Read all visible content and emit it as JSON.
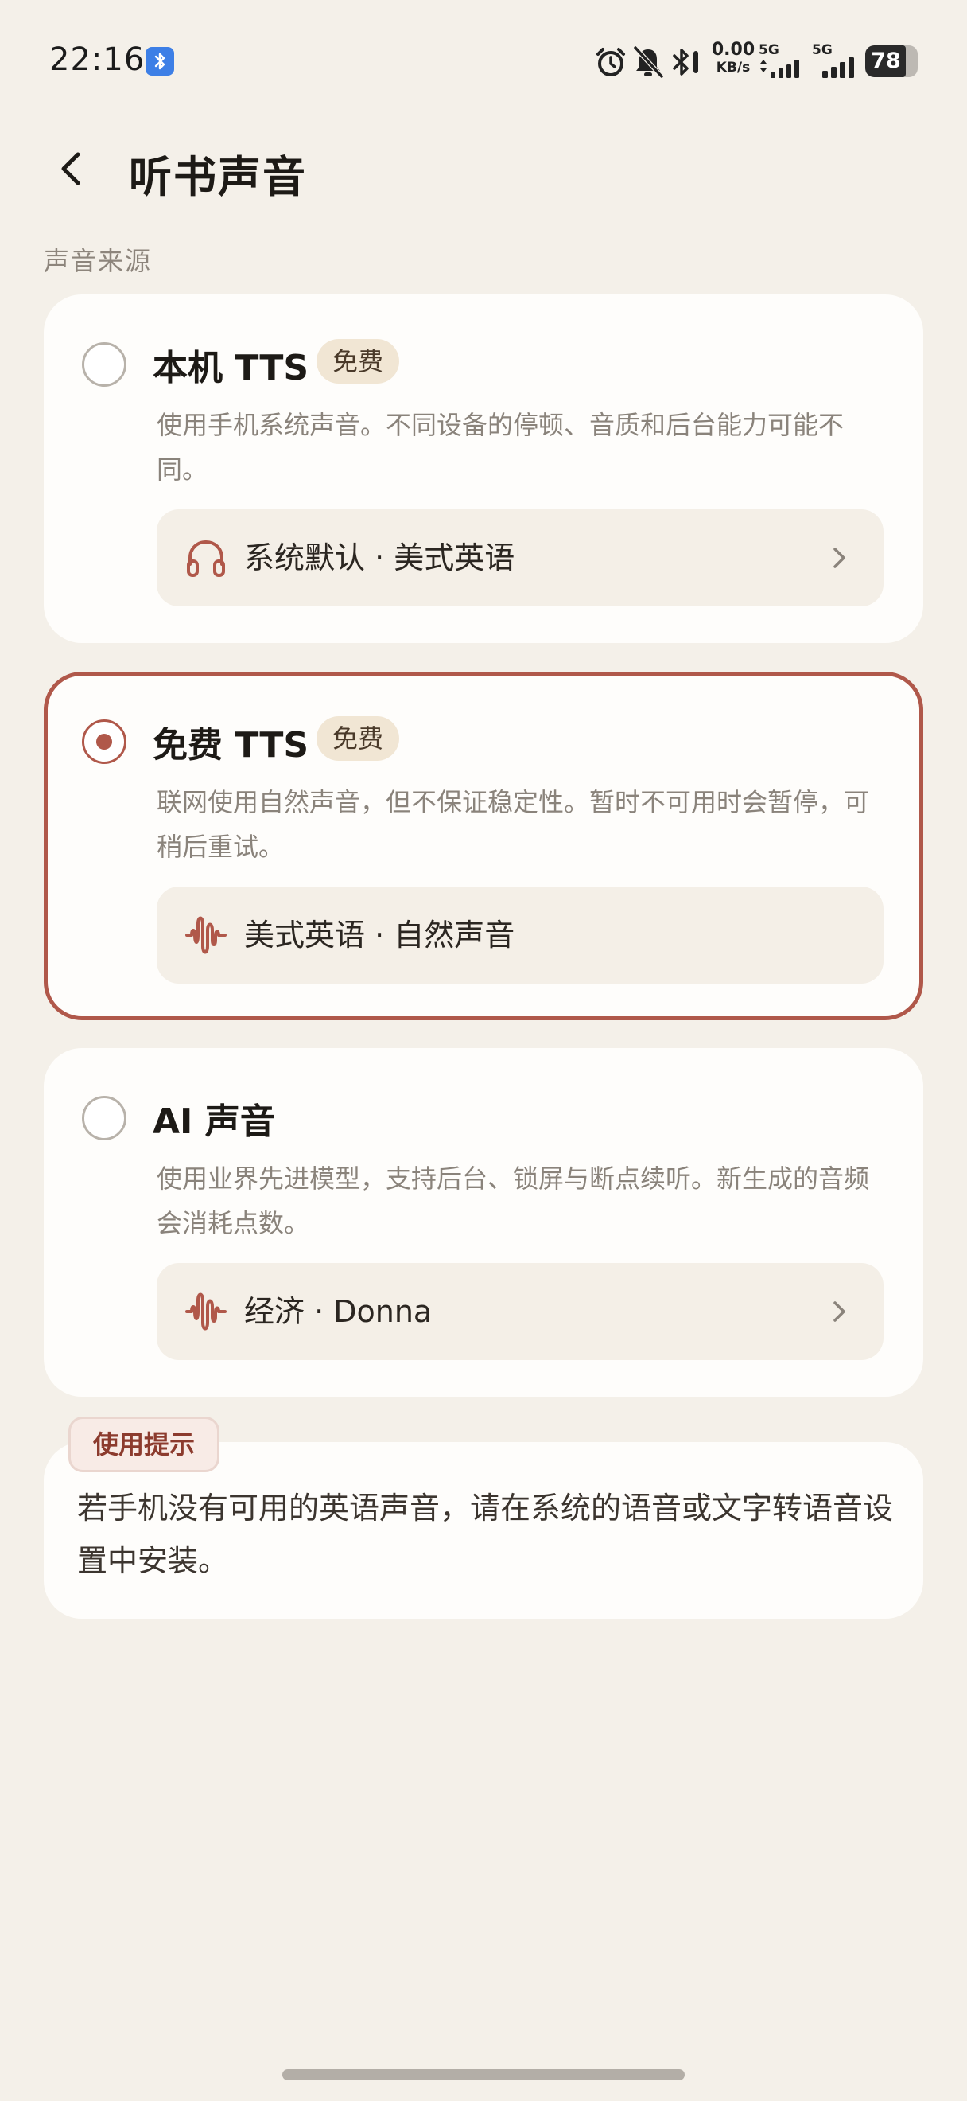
{
  "status_bar": {
    "time": "22:16",
    "net_speed_value": "0.00",
    "net_speed_unit": "KB/s",
    "sim1_label": "5G",
    "sim2_label": "5G",
    "battery_level": "78",
    "battery_fraction": 0.78
  },
  "header": {
    "title": "听书声音"
  },
  "section": {
    "label": "声音来源"
  },
  "options": [
    {
      "title": "本机 TTS",
      "tag": "免费",
      "description": "使用手机系统声音。不同设备的停顿、音质和后台能力可能不同。",
      "voice": "系统默认 · 美式英语",
      "voice_icon": "headphones-icon",
      "selected": false
    },
    {
      "title": "免费 TTS",
      "tag": "免费",
      "description": "联网使用自然声音，但不保证稳定性。暂时不可用时会暂停，可稍后重试。",
      "voice": "美式英语 · 自然声音",
      "voice_icon": "waveform-icon",
      "selected": true
    },
    {
      "title": "AI 声音",
      "description": "使用业界先进模型，支持后台、锁屏与断点续听。新生成的音频会消耗点数。",
      "voice": "经济 · Donna",
      "voice_icon": "waveform-icon",
      "selected": false
    }
  ],
  "tip": {
    "badge": "使用提示",
    "text": "若手机没有可用的英语声音，请在系统的语音或文字转语音设置中安装。"
  },
  "colors": {
    "background": "#f4f0e9",
    "card": "#fefdfb",
    "accent": "#b0584a",
    "tag_bg": "#f1e6d4",
    "row_bg": "#f4efe7"
  }
}
